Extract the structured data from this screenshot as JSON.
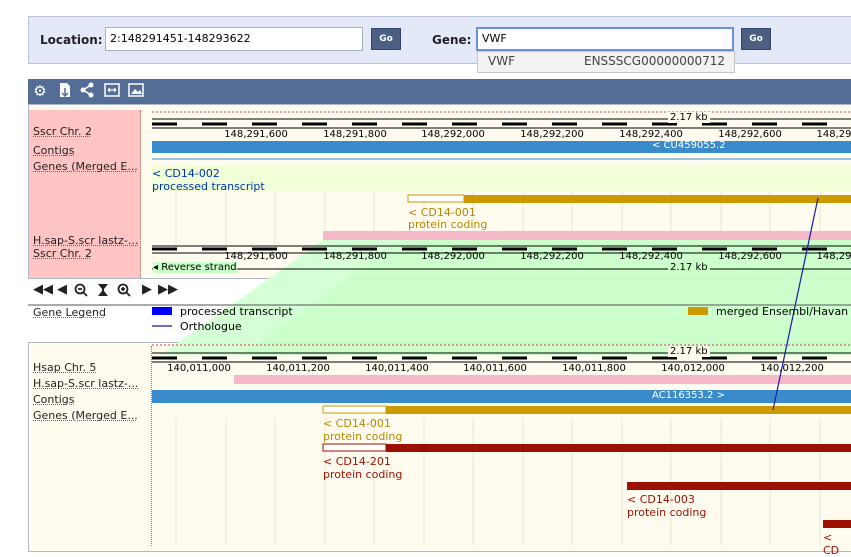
{
  "search": {
    "location_label": "Location:",
    "location_value": "2:148291451-148293622",
    "gene_label": "Gene:",
    "gene_value": "VWF",
    "go_label": "Go",
    "suggestion_name": "VWF",
    "suggestion_id": "ENSSSCG00000000712"
  },
  "toolbar": {
    "icons": [
      "gear-icon",
      "export-icon",
      "share-icon",
      "resize-icon",
      "image-icon"
    ]
  },
  "top_panel": {
    "track_labels": [
      "Sscr Chr. 2",
      "Contigs",
      "Genes (Merged E...",
      "H.sap-S.scr lastz-...",
      "Sscr Chr. 2"
    ],
    "scale": "2.17 kb",
    "ticks": [
      "148,291,600",
      "148,291,800",
      "148,292,000",
      "148,292,200",
      "148,292,400",
      "148,292,600",
      "148,29"
    ],
    "contig": "< CU459055.2",
    "gene1_name": "< CD14-002",
    "gene1_type": "processed transcript",
    "gene2_name": "< CD14-001",
    "gene2_type": "protein coding",
    "strand": "Reverse strand"
  },
  "legend": {
    "label": "Gene Legend",
    "items": [
      "processed transcript",
      "Orthologue",
      "merged Ensembl/Havan"
    ],
    "colors": {
      "processed": "#0000ff",
      "orthologue": "#1a1aa6",
      "merged": "#cc9900"
    }
  },
  "bottom_panel": {
    "track_labels": [
      "Hsap Chr. 5",
      "H.sap-S.scr lastz-...",
      "Contigs",
      "Genes (Merged E..."
    ],
    "scale": "2.17 kb",
    "ticks": [
      "140,011,000",
      "140,011,200",
      "140,011,400",
      "140,011,600",
      "140,011,800",
      "140,012,000",
      "140,012,200"
    ],
    "contig": "AC116353.2 >",
    "genes": [
      {
        "name": "< CD14-001",
        "type": "protein coding"
      },
      {
        "name": "< CD14-201",
        "type": "protein coding"
      },
      {
        "name": "< CD14-003",
        "type": "protein coding"
      },
      {
        "name": "< CD"
      }
    ]
  },
  "colors": {
    "contig": "#3a8bcc",
    "gold": "#cc9900",
    "darkred": "#9b1000",
    "pink": "#f5b8c8",
    "green": "#c8ffc8",
    "label_bg": "#ffc4c4"
  }
}
